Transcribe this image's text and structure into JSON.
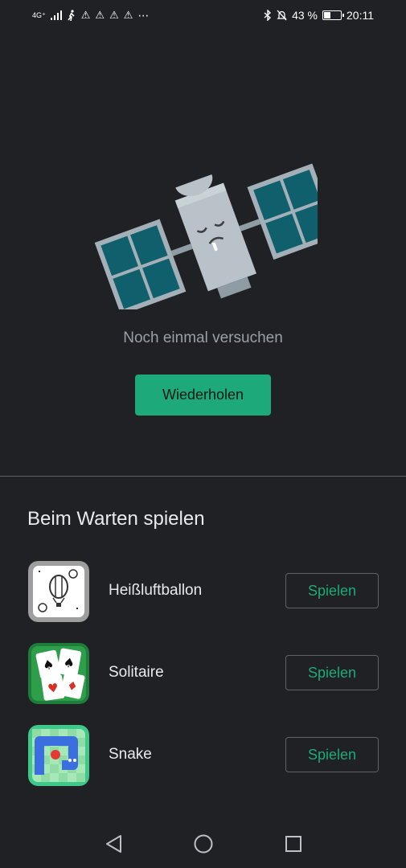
{
  "status_bar": {
    "network": "4G⁺",
    "battery_percent": "43 %",
    "battery_level": 0.43,
    "time": "20:11",
    "icons": [
      "signal-icon",
      "walk-icon",
      "warning-icon",
      "warning-icon",
      "warning-icon",
      "warning-icon",
      "more-icon",
      "bluetooth-icon",
      "notifications-off-icon",
      "battery-icon"
    ]
  },
  "error": {
    "message": "Noch einmal versuchen",
    "retry_label": "Wiederholen",
    "illustration": "sleeping-satellite"
  },
  "games_section": {
    "title": "Beim Warten spielen",
    "games": [
      {
        "name": "Heißluftballon",
        "button_label": "Spielen",
        "icon": "hot-air-balloon-icon"
      },
      {
        "name": "Solitaire",
        "button_label": "Spielen",
        "icon": "solitaire-cards-icon"
      },
      {
        "name": "Snake",
        "button_label": "Spielen",
        "icon": "snake-game-icon"
      }
    ]
  },
  "nav_bar": {
    "buttons": [
      "back-icon",
      "home-icon",
      "recents-icon"
    ]
  },
  "colors": {
    "background": "#202124",
    "accent": "#1ea97a",
    "text_secondary": "#9aa0a6"
  }
}
